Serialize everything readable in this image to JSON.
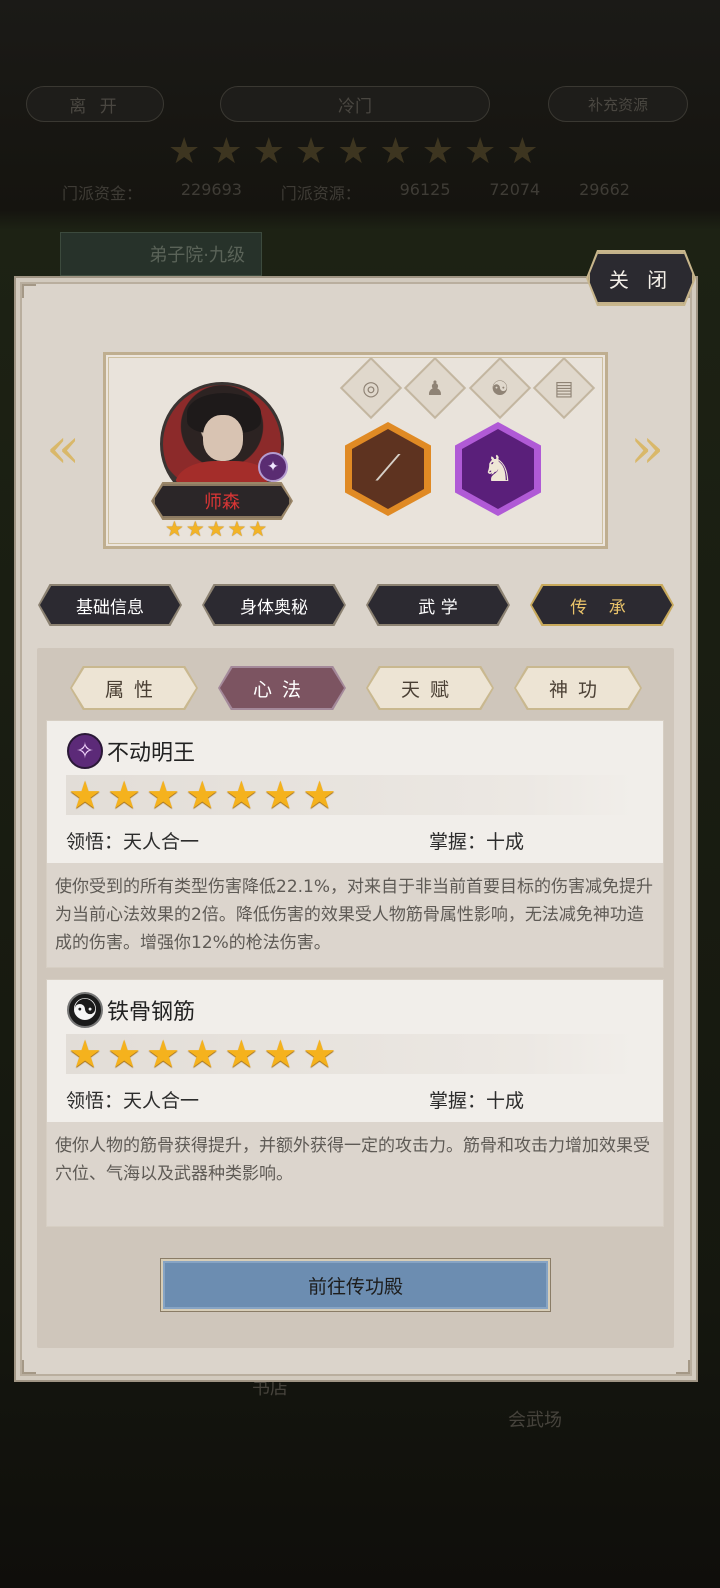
{
  "background": {
    "leave_label": "离 开",
    "sect_name": "冷门",
    "supplement_label": "补充资源",
    "star_count": 9,
    "resources": [
      "门派资金：",
      "229693",
      "门派资源：",
      "96125",
      "72074",
      "29662"
    ],
    "courtyard_label": "弟子院·九级",
    "bookshop_label": "书店",
    "arena_label": "会武场"
  },
  "panel": {
    "close_label": "关 闭",
    "character": {
      "name": "师森",
      "star_count": 5
    },
    "main_tabs": [
      {
        "label": "基础信息",
        "active": false
      },
      {
        "label": "身体奥秘",
        "active": false
      },
      {
        "label": "武 学",
        "active": false
      },
      {
        "label": "传 承",
        "active": true
      }
    ],
    "sub_tabs": [
      {
        "label": "属性",
        "active": false
      },
      {
        "label": "心法",
        "active": true
      },
      {
        "label": "天赋",
        "active": false
      },
      {
        "label": "神功",
        "active": false
      }
    ],
    "skills": [
      {
        "name": "不动明王",
        "icon": "purple-sword-icon",
        "star_count": 7,
        "comprehension_label": "领悟：",
        "comprehension_value": "天人合一",
        "mastery_label": "掌握：",
        "mastery_value": "十成",
        "description": "使你受到的所有类型伤害降低22.1%，对来自于非当前首要目标的伤害减免提升为当前心法效果的2倍。降低伤害的效果受人物筋骨属性影响，无法减免神功造成的伤害。增强你12%的枪法伤害。"
      },
      {
        "name": "铁骨钢筋",
        "icon": "yin-yang-icon",
        "star_count": 7,
        "comprehension_label": "领悟：",
        "comprehension_value": "天人合一",
        "mastery_label": "掌握：",
        "mastery_value": "十成",
        "description": "使你人物的筋骨获得提升，并额外获得一定的攻击力。筋骨和攻击力增加效果受穴位、气海以及武器种类影响。"
      }
    ],
    "goto_label": "前往传功殿"
  },
  "colors": {
    "panel_bg": "#dbd4cb",
    "active_subtab": "#7c5461",
    "star_gold": "#f5b21d",
    "name_red": "#d93535",
    "goto_button": "#6c8db1"
  }
}
